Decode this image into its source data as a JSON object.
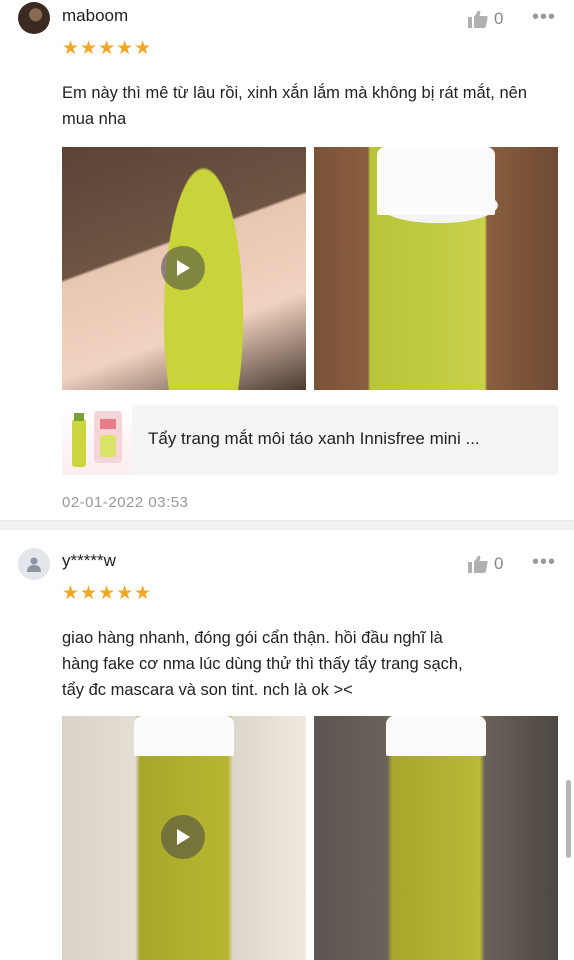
{
  "reviews": [
    {
      "username": "maboom",
      "rating_stars": "★★★★★",
      "rating": 5,
      "like_count": "0",
      "comment": "Em này thì mê từ lâu rồi, xinh xắn lắm mà không bị rát mắt, nên mua nha",
      "product_name": "Tẩy trang mắt môi táo xanh Innisfree mini ...",
      "timestamp": "02-01-2022 03:53"
    },
    {
      "username": "y*****w",
      "rating_stars": "★★★★★",
      "rating": 5,
      "like_count": "0",
      "comment_lines": [
        "giao hàng nhanh, đóng gói cẩn thận. hồi đầu nghĩ là",
        "hàng fake cơ nma lúc dùng thử thì thấy tẩy trang sạch,",
        "tẩy đc mascara và son tint. nch là ok ><"
      ]
    }
  ],
  "colors": {
    "star": "#f5a623",
    "muted": "#999999",
    "divider": "#f2f2f2"
  },
  "icons": [
    "thumbs-up-icon",
    "more-icon",
    "play-icon",
    "default-avatar-icon"
  ]
}
